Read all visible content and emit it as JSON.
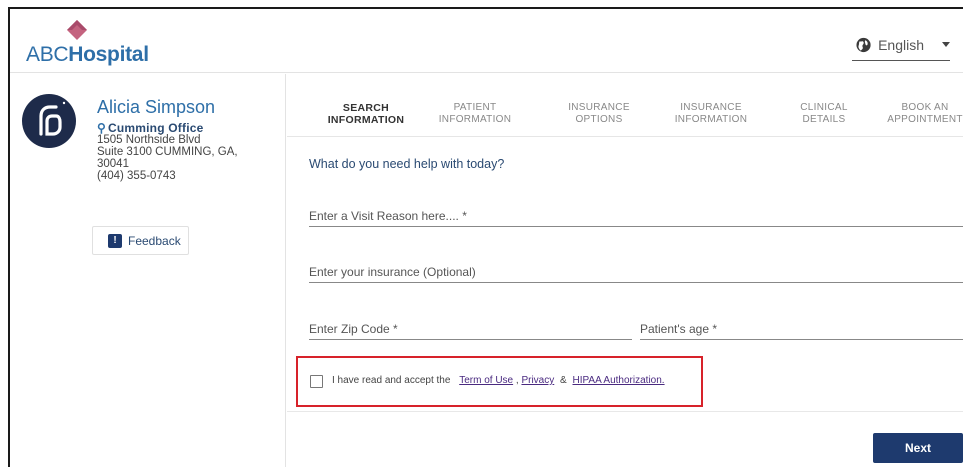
{
  "brand": {
    "logo_prefix": "ABC",
    "logo_bold": "Hospital",
    "accent": "#2e6fa8",
    "diamond_color": "#c4637f"
  },
  "language": {
    "selected": "English",
    "icon": "globe-icon"
  },
  "provider": {
    "name": "Alicia Simpson",
    "office": "Cumming Office",
    "address_lines": [
      "1505 Northside Blvd",
      "Suite 3100 CUMMING, GA,",
      "30041",
      "(404) 355-0743"
    ]
  },
  "feedback_label": "Feedback",
  "steps": [
    {
      "line1": "SEARCH",
      "line2": "INFORMATION",
      "active": true
    },
    {
      "line1": "PATIENT",
      "line2": "INFORMATION",
      "active": false
    },
    {
      "line1": "INSURANCE",
      "line2": "OPTIONS",
      "active": false
    },
    {
      "line1": "INSURANCE",
      "line2": "INFORMATION",
      "active": false
    },
    {
      "line1": "CLINICAL",
      "line2": "DETAILS",
      "active": false
    },
    {
      "line1": "BOOK AN",
      "line2": "APPOINTMENT",
      "active": false
    }
  ],
  "form": {
    "question": "What do you need help with today?",
    "visit_reason_placeholder": "Enter a Visit Reason here.... *",
    "insurance_placeholder": "Enter your insurance (Optional)",
    "zip_placeholder": "Enter Zip Code *",
    "age_placeholder": "Patient's age *"
  },
  "consent": {
    "prefix": "I have read and accept the",
    "terms_link": "Term of Use",
    "comma": ",",
    "privacy_link": "Privacy",
    "ampersand": "&",
    "hipaa_link": "HIPAA Authorization."
  },
  "next_label": "Next"
}
